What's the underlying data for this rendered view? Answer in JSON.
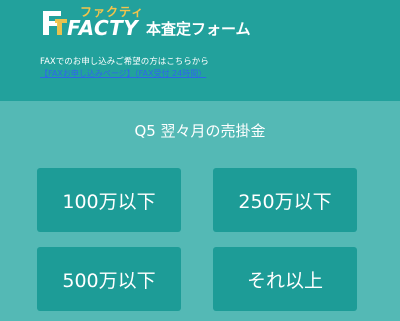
{
  "header": {
    "logo_kana": "ファクティ",
    "logo_word": "FACTY",
    "form_title": "本査定フォーム",
    "fax_note": "FAXでのお申し込みご希望の方はこちらから",
    "fax_link_1": "【FAXお申し込みページ】",
    "fax_link_2": "（FAX受付 24時間）"
  },
  "question": {
    "label": "Q5 翌々月の売掛金"
  },
  "options": [
    {
      "label": "100万以下"
    },
    {
      "label": "250万以下"
    },
    {
      "label": "500万以下"
    },
    {
      "label": "それ以上"
    }
  ],
  "colors": {
    "header_bg": "#22a19c",
    "body_bg": "#54b9b5",
    "option_bg": "#1d9c97",
    "logo_kana": "#f3c44b",
    "link": "#2f67e9"
  }
}
